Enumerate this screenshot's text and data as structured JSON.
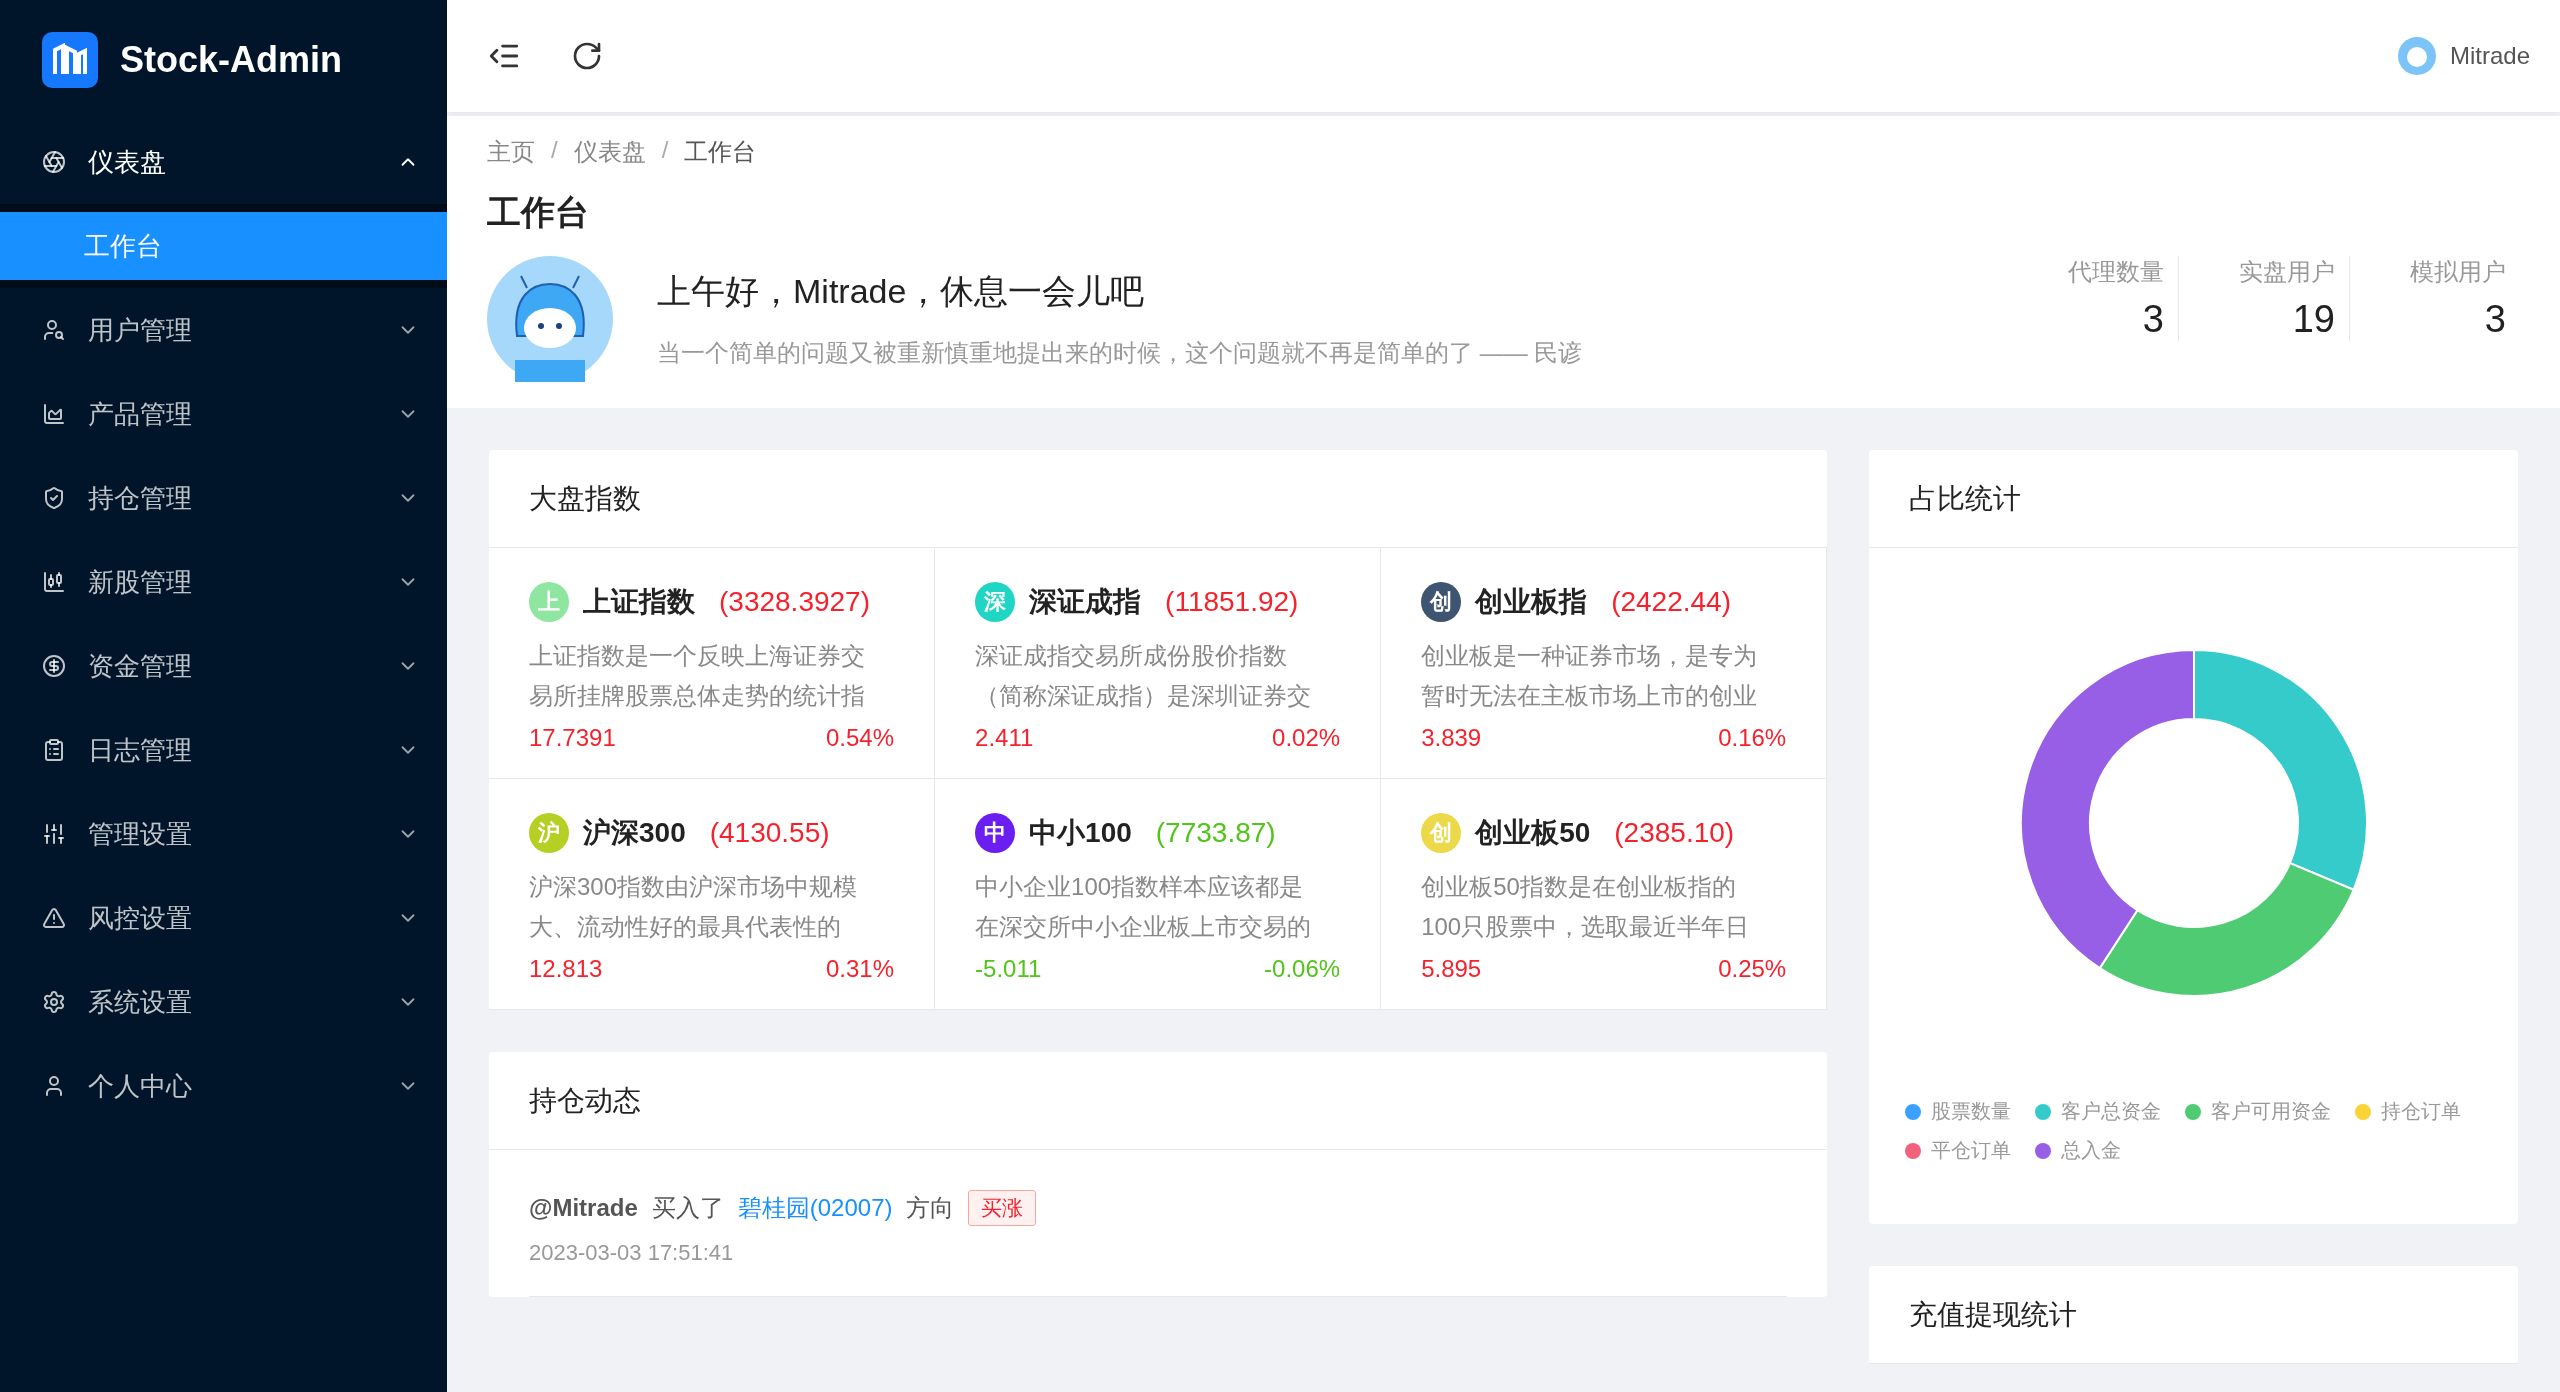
{
  "brand": {
    "name": "Stock-Admin"
  },
  "menu": [
    {
      "label": "仪表盘",
      "expanded": true,
      "children": [
        {
          "label": "工作台",
          "selected": true
        }
      ]
    },
    {
      "label": "用户管理",
      "expanded": false
    },
    {
      "label": "产品管理",
      "expanded": false
    },
    {
      "label": "持仓管理",
      "expanded": false
    },
    {
      "label": "新股管理",
      "expanded": false
    },
    {
      "label": "资金管理",
      "expanded": false
    },
    {
      "label": "日志管理",
      "expanded": false
    },
    {
      "label": "管理设置",
      "expanded": false
    },
    {
      "label": "风控设置",
      "expanded": false
    },
    {
      "label": "系统设置",
      "expanded": false
    },
    {
      "label": "个人中心",
      "expanded": false
    }
  ],
  "header": {
    "user": "Mitrade"
  },
  "breadcrumb": {
    "separator": "/",
    "items": [
      "主页",
      "仪表盘",
      "工作台"
    ]
  },
  "page_title": "工作台",
  "greeting": "上午好，Mitrade，休息一会儿吧",
  "quote": "当一个简单的问题又被重新慎重地提出来的时候，这个问题就不再是简单的了 —— 民谚",
  "stats": [
    {
      "label": "代理数量",
      "value": "3"
    },
    {
      "label": "实盘用户",
      "value": "19"
    },
    {
      "label": "模拟用户",
      "value": "3"
    }
  ],
  "market": {
    "title": "大盘指数",
    "indices": [
      {
        "badge": "上",
        "color": "#8fe6a0",
        "name": "上证指数",
        "value": "(3328.3927)",
        "rising": true,
        "description": [
          "上证指数是一个反映上海证券交",
          "易所挂牌股票总体走势的统计指"
        ],
        "change": "17.7391",
        "percent": "0.54%"
      },
      {
        "badge": "深",
        "color": "#1fd6c4",
        "name": "深证成指",
        "value": "(11851.92)",
        "rising": true,
        "description": [
          "深证成指交易所成份股价指数",
          "（简称深证成指）是深圳证券交"
        ],
        "change": "2.411",
        "percent": "0.02%"
      },
      {
        "badge": "创",
        "color": "#3d5570",
        "name": "创业板指",
        "value": "(2422.44)",
        "rising": true,
        "description": [
          "创业板是一种证券市场，是专为",
          "暂时无法在主板市场上市的创业"
        ],
        "change": "3.839",
        "percent": "0.16%"
      },
      {
        "badge": "沪",
        "color": "#b5cf24",
        "name": "沪深300",
        "value": "(4130.55)",
        "rising": true,
        "description": [
          "沪深300指数由沪深市场中规模",
          "大、流动性好的最具代表性的"
        ],
        "change": "12.813",
        "percent": "0.31%"
      },
      {
        "badge": "中",
        "color": "#6a1ef0",
        "name": "中小100",
        "value": "(7733.87)",
        "rising": false,
        "description": [
          "中小企业100指数样本应该都是",
          "在深交所中小企业板上市交易的"
        ],
        "change": "-5.011",
        "percent": "-0.06%"
      },
      {
        "badge": "创",
        "color": "#ebd94a",
        "name": "创业板50",
        "value": "(2385.10)",
        "rising": true,
        "description": [
          "创业板50指数是在创业板指的",
          "100只股票中，选取最近半年日"
        ],
        "change": "5.895",
        "percent": "0.25%"
      }
    ]
  },
  "positions": {
    "title": "持仓动态",
    "items": [
      {
        "user": "@Mitrade",
        "action": "买入了",
        "stock": "碧桂园(02007)",
        "direction_label": "方向",
        "direction": "买涨",
        "time": "2023-03-03 17:51:41"
      }
    ]
  },
  "ratio": {
    "title": "占比统计",
    "legend": [
      {
        "label": "股票数量",
        "color": "#3ba1ff"
      },
      {
        "label": "客户总资金",
        "color": "#36cbcb"
      },
      {
        "label": "客户可用资金",
        "color": "#4ecb73"
      },
      {
        "label": "持仓订单",
        "color": "#fad337"
      },
      {
        "label": "平仓订单",
        "color": "#f2637b"
      },
      {
        "label": "总入金",
        "color": "#975fe5"
      }
    ]
  },
  "recharge": {
    "title": "充值提现统计"
  }
}
